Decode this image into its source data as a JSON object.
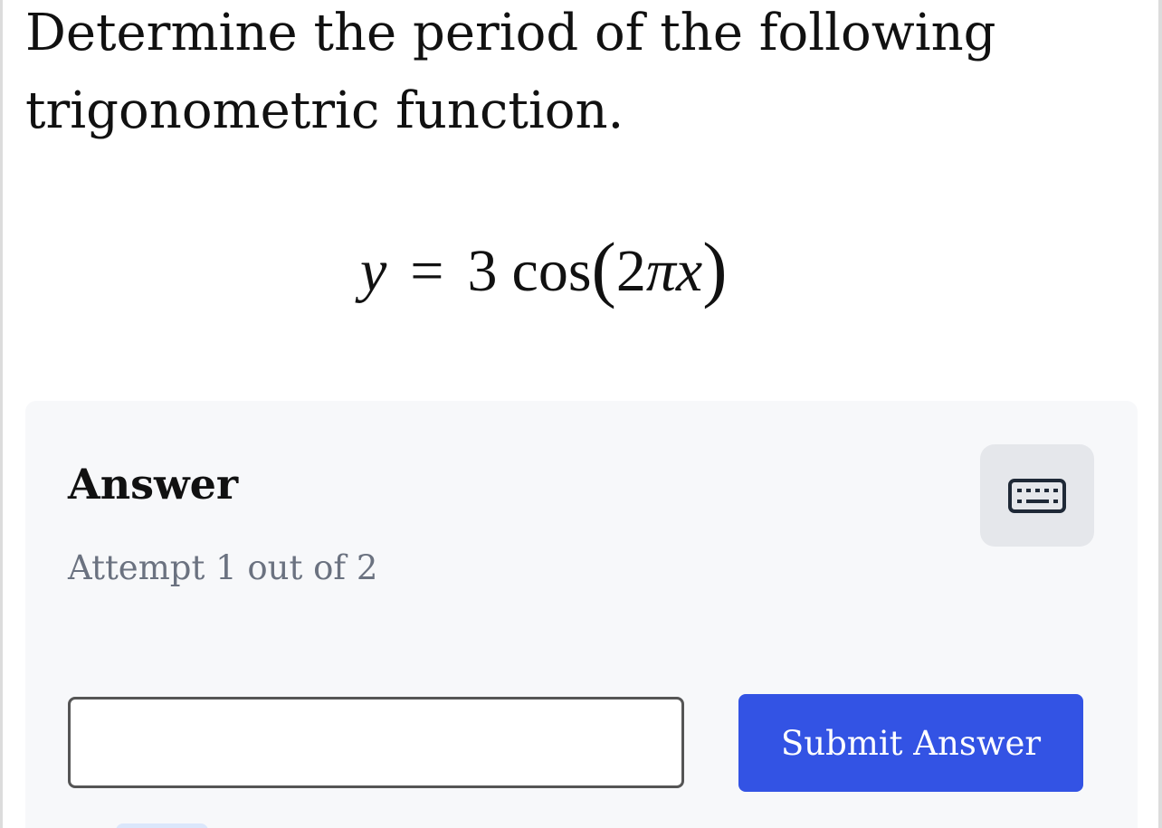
{
  "question": {
    "text": "Determine the period of the following trigonometric function."
  },
  "equation": {
    "lhs": "y",
    "op": "=",
    "coefficient": "3",
    "function": "cos",
    "open_paren": "(",
    "arg_number": "2",
    "arg_pi": "π",
    "arg_var": "x",
    "close_paren": ")"
  },
  "answer_panel": {
    "heading": "Answer",
    "attempt_text": "Attempt 1 out of 2",
    "keyboard_icon": "keyboard-icon",
    "input_value": "",
    "submit_label": "Submit Answer"
  },
  "colors": {
    "panel_background": "#f7f8fa",
    "submit_background": "#3353e4",
    "attempt_text": "#6b7280",
    "keyboard_button_background": "#e5e7eb"
  }
}
